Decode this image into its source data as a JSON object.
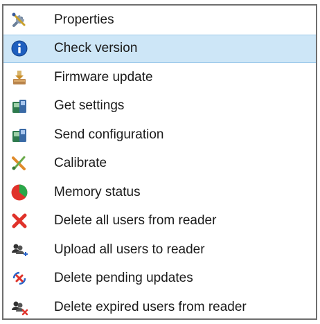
{
  "menu": {
    "items": [
      {
        "label": "Properties",
        "icon": "wrench-screwdriver-icon",
        "selected": false
      },
      {
        "label": "Check version",
        "icon": "info-icon",
        "selected": true
      },
      {
        "label": "Firmware update",
        "icon": "firmware-install-icon",
        "selected": false
      },
      {
        "label": "Get settings",
        "icon": "device-settings-icon",
        "selected": false
      },
      {
        "label": "Send configuration",
        "icon": "device-config-icon",
        "selected": false
      },
      {
        "label": "Calibrate",
        "icon": "calibrate-icon",
        "selected": false
      },
      {
        "label": "Memory status",
        "icon": "memory-pie-icon",
        "selected": false
      },
      {
        "label": "Delete all users from reader",
        "icon": "red-x-icon",
        "selected": false
      },
      {
        "label": "Upload all users to reader",
        "icon": "users-upload-icon",
        "selected": false
      },
      {
        "label": "Delete pending updates",
        "icon": "delete-pending-icon",
        "selected": false
      },
      {
        "label": "Delete expired users from reader",
        "icon": "users-delete-icon",
        "selected": false
      }
    ]
  },
  "colors": {
    "selection": "#cde6f7",
    "selection_border": "#9cc9ea",
    "border": "#6e6e6e",
    "text": "#1a1a1a"
  }
}
